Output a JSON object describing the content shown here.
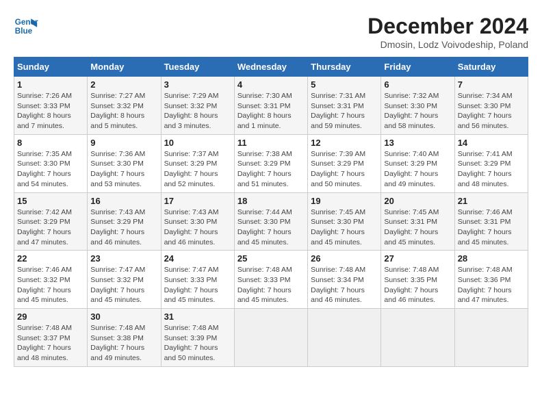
{
  "header": {
    "logo_line1": "General",
    "logo_line2": "Blue",
    "title": "December 2024",
    "subtitle": "Dmosin, Lodz Voivodeship, Poland"
  },
  "weekdays": [
    "Sunday",
    "Monday",
    "Tuesday",
    "Wednesday",
    "Thursday",
    "Friday",
    "Saturday"
  ],
  "weeks": [
    [
      {
        "day": "1",
        "detail": "Sunrise: 7:26 AM\nSunset: 3:33 PM\nDaylight: 8 hours\nand 7 minutes."
      },
      {
        "day": "2",
        "detail": "Sunrise: 7:27 AM\nSunset: 3:32 PM\nDaylight: 8 hours\nand 5 minutes."
      },
      {
        "day": "3",
        "detail": "Sunrise: 7:29 AM\nSunset: 3:32 PM\nDaylight: 8 hours\nand 3 minutes."
      },
      {
        "day": "4",
        "detail": "Sunrise: 7:30 AM\nSunset: 3:31 PM\nDaylight: 8 hours\nand 1 minute."
      },
      {
        "day": "5",
        "detail": "Sunrise: 7:31 AM\nSunset: 3:31 PM\nDaylight: 7 hours\nand 59 minutes."
      },
      {
        "day": "6",
        "detail": "Sunrise: 7:32 AM\nSunset: 3:30 PM\nDaylight: 7 hours\nand 58 minutes."
      },
      {
        "day": "7",
        "detail": "Sunrise: 7:34 AM\nSunset: 3:30 PM\nDaylight: 7 hours\nand 56 minutes."
      }
    ],
    [
      {
        "day": "8",
        "detail": "Sunrise: 7:35 AM\nSunset: 3:30 PM\nDaylight: 7 hours\nand 54 minutes."
      },
      {
        "day": "9",
        "detail": "Sunrise: 7:36 AM\nSunset: 3:30 PM\nDaylight: 7 hours\nand 53 minutes."
      },
      {
        "day": "10",
        "detail": "Sunrise: 7:37 AM\nSunset: 3:29 PM\nDaylight: 7 hours\nand 52 minutes."
      },
      {
        "day": "11",
        "detail": "Sunrise: 7:38 AM\nSunset: 3:29 PM\nDaylight: 7 hours\nand 51 minutes."
      },
      {
        "day": "12",
        "detail": "Sunrise: 7:39 AM\nSunset: 3:29 PM\nDaylight: 7 hours\nand 50 minutes."
      },
      {
        "day": "13",
        "detail": "Sunrise: 7:40 AM\nSunset: 3:29 PM\nDaylight: 7 hours\nand 49 minutes."
      },
      {
        "day": "14",
        "detail": "Sunrise: 7:41 AM\nSunset: 3:29 PM\nDaylight: 7 hours\nand 48 minutes."
      }
    ],
    [
      {
        "day": "15",
        "detail": "Sunrise: 7:42 AM\nSunset: 3:29 PM\nDaylight: 7 hours\nand 47 minutes."
      },
      {
        "day": "16",
        "detail": "Sunrise: 7:43 AM\nSunset: 3:29 PM\nDaylight: 7 hours\nand 46 minutes."
      },
      {
        "day": "17",
        "detail": "Sunrise: 7:43 AM\nSunset: 3:30 PM\nDaylight: 7 hours\nand 46 minutes."
      },
      {
        "day": "18",
        "detail": "Sunrise: 7:44 AM\nSunset: 3:30 PM\nDaylight: 7 hours\nand 45 minutes."
      },
      {
        "day": "19",
        "detail": "Sunrise: 7:45 AM\nSunset: 3:30 PM\nDaylight: 7 hours\nand 45 minutes."
      },
      {
        "day": "20",
        "detail": "Sunrise: 7:45 AM\nSunset: 3:31 PM\nDaylight: 7 hours\nand 45 minutes."
      },
      {
        "day": "21",
        "detail": "Sunrise: 7:46 AM\nSunset: 3:31 PM\nDaylight: 7 hours\nand 45 minutes."
      }
    ],
    [
      {
        "day": "22",
        "detail": "Sunrise: 7:46 AM\nSunset: 3:32 PM\nDaylight: 7 hours\nand 45 minutes."
      },
      {
        "day": "23",
        "detail": "Sunrise: 7:47 AM\nSunset: 3:32 PM\nDaylight: 7 hours\nand 45 minutes."
      },
      {
        "day": "24",
        "detail": "Sunrise: 7:47 AM\nSunset: 3:33 PM\nDaylight: 7 hours\nand 45 minutes."
      },
      {
        "day": "25",
        "detail": "Sunrise: 7:48 AM\nSunset: 3:33 PM\nDaylight: 7 hours\nand 45 minutes."
      },
      {
        "day": "26",
        "detail": "Sunrise: 7:48 AM\nSunset: 3:34 PM\nDaylight: 7 hours\nand 46 minutes."
      },
      {
        "day": "27",
        "detail": "Sunrise: 7:48 AM\nSunset: 3:35 PM\nDaylight: 7 hours\nand 46 minutes."
      },
      {
        "day": "28",
        "detail": "Sunrise: 7:48 AM\nSunset: 3:36 PM\nDaylight: 7 hours\nand 47 minutes."
      }
    ],
    [
      {
        "day": "29",
        "detail": "Sunrise: 7:48 AM\nSunset: 3:37 PM\nDaylight: 7 hours\nand 48 minutes."
      },
      {
        "day": "30",
        "detail": "Sunrise: 7:48 AM\nSunset: 3:38 PM\nDaylight: 7 hours\nand 49 minutes."
      },
      {
        "day": "31",
        "detail": "Sunrise: 7:48 AM\nSunset: 3:39 PM\nDaylight: 7 hours\nand 50 minutes."
      },
      {
        "day": "",
        "detail": ""
      },
      {
        "day": "",
        "detail": ""
      },
      {
        "day": "",
        "detail": ""
      },
      {
        "day": "",
        "detail": ""
      }
    ]
  ]
}
